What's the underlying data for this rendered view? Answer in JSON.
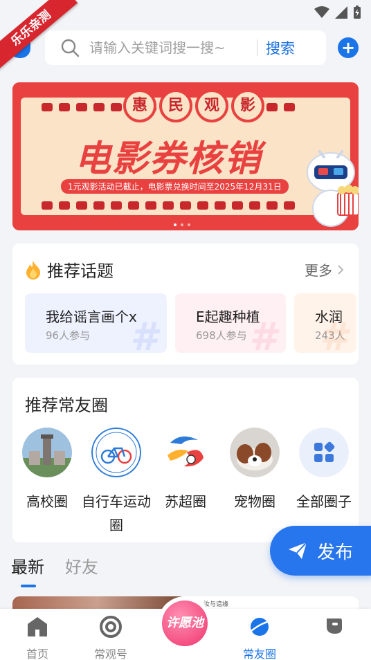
{
  "status": {
    "icons": [
      "wifi-icon",
      "signal-icon",
      "battery-icon"
    ]
  },
  "ribbon": {
    "text": "乐乐亲测"
  },
  "search": {
    "placeholder": "请输入关键词搜一搜~",
    "button": "搜索"
  },
  "add_button": {
    "symbol": "+"
  },
  "banner": {
    "badges": [
      "惠",
      "民",
      "观",
      "影"
    ],
    "title": "电影券核销",
    "subtitle": "1元观影活动已截止，电影票兑换时间至2025年12月31日",
    "pages": 3,
    "active_page": 1
  },
  "topics": {
    "title": "推荐话题",
    "more": "更多",
    "items": [
      {
        "name": "我给谣言画个x",
        "count": "96人参与"
      },
      {
        "name": "E起趣种植",
        "count": "698人参与"
      },
      {
        "name": "水润",
        "count": "243人"
      }
    ]
  },
  "circles": {
    "title": "推荐常友圈",
    "items": [
      {
        "label": "高校圈"
      },
      {
        "label": "自行车运动圈"
      },
      {
        "label": "苏超圈"
      },
      {
        "label": "宠物圈"
      },
      {
        "label": "全部圈子"
      }
    ]
  },
  "publish": {
    "label": "发布"
  },
  "feed": {
    "tabs": [
      "最新",
      "好友"
    ],
    "active_tab": 0,
    "preview_text": "汝与谙缘"
  },
  "nav": {
    "items": [
      {
        "label": "首页"
      },
      {
        "label": "常观号"
      },
      {
        "label": "许愿池"
      },
      {
        "label": "常友圈"
      },
      {
        "label": ""
      }
    ],
    "active": 3
  },
  "colors": {
    "accent": "#1b74e8",
    "banner": "#e8413f",
    "wish": "#f0356e"
  }
}
